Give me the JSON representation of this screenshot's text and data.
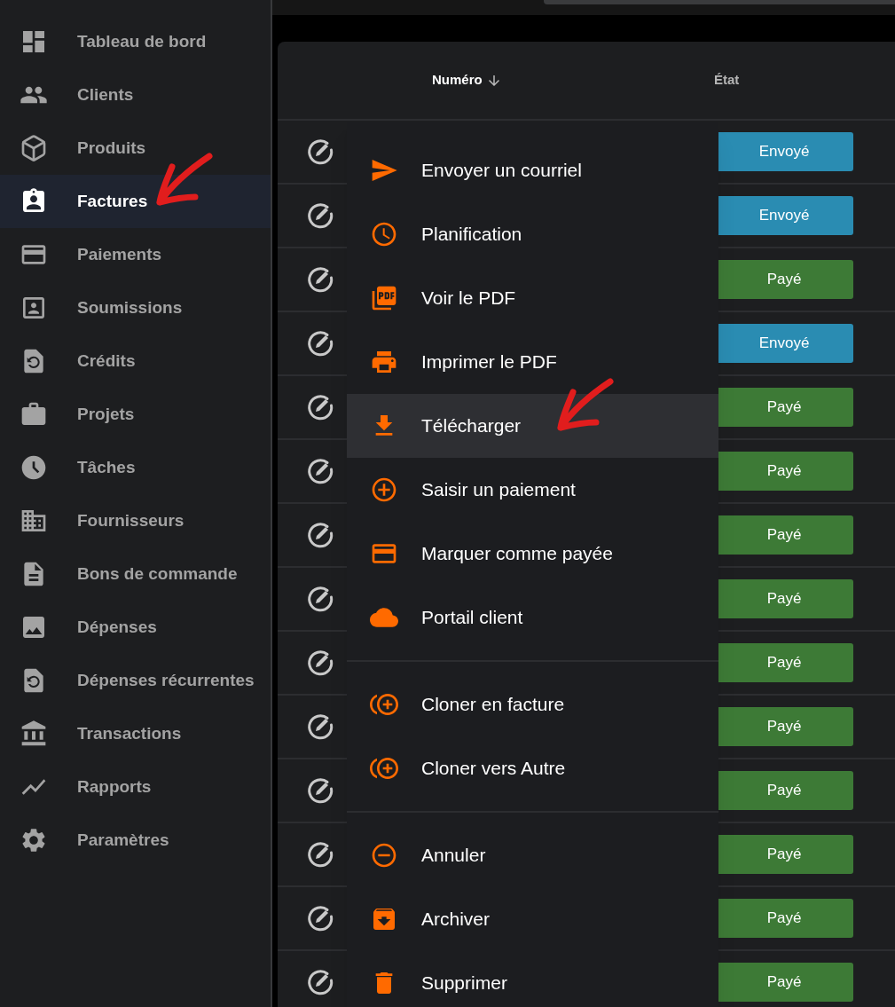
{
  "sidebar": {
    "items": [
      {
        "label": "Tableau de bord",
        "selected": false
      },
      {
        "label": "Clients",
        "selected": false
      },
      {
        "label": "Produits",
        "selected": false
      },
      {
        "label": "Factures",
        "selected": true
      },
      {
        "label": "Paiements",
        "selected": false
      },
      {
        "label": "Soumissions",
        "selected": false
      },
      {
        "label": "Crédits",
        "selected": false
      },
      {
        "label": "Projets",
        "selected": false
      },
      {
        "label": "Tâches",
        "selected": false
      },
      {
        "label": "Fournisseurs",
        "selected": false
      },
      {
        "label": "Bons de commande",
        "selected": false
      },
      {
        "label": "Dépenses",
        "selected": false
      },
      {
        "label": "Dépenses récurrentes",
        "selected": false
      },
      {
        "label": "Transactions",
        "selected": false
      },
      {
        "label": "Rapports",
        "selected": false
      },
      {
        "label": "Paramètres",
        "selected": false
      }
    ]
  },
  "table": {
    "columns": [
      {
        "label": "Numéro",
        "sorted": true
      },
      {
        "label": "État",
        "sorted": false
      }
    ],
    "rows": [
      {
        "status": {
          "label": "Envoyé",
          "color": "#2a8cb2"
        }
      },
      {
        "status": {
          "label": "Envoyé",
          "color": "#2a8cb2"
        }
      },
      {
        "status": {
          "label": "Payé",
          "color": "#3d7a36"
        }
      },
      {
        "status": {
          "label": "Envoyé",
          "color": "#2a8cb2"
        }
      },
      {
        "status": {
          "label": "Payé",
          "color": "#3d7a36"
        }
      },
      {
        "status": {
          "label": "Payé",
          "color": "#3d7a36"
        }
      },
      {
        "status": {
          "label": "Payé",
          "color": "#3d7a36"
        }
      },
      {
        "status": {
          "label": "Payé",
          "color": "#3d7a36"
        }
      },
      {
        "status": {
          "label": "Payé",
          "color": "#3d7a36"
        }
      },
      {
        "status": {
          "label": "Payé",
          "color": "#3d7a36"
        }
      },
      {
        "status": {
          "label": "Payé",
          "color": "#3d7a36"
        }
      },
      {
        "status": {
          "label": "Payé",
          "color": "#3d7a36"
        }
      },
      {
        "status": {
          "label": "Payé",
          "color": "#3d7a36"
        }
      },
      {
        "status": {
          "label": "Payé",
          "color": "#3d7a36"
        }
      }
    ]
  },
  "menu": {
    "groups": [
      [
        {
          "label": "Envoyer un courriel",
          "highlighted": false
        },
        {
          "label": "Planification",
          "highlighted": false
        },
        {
          "label": "Voir le PDF",
          "highlighted": false
        },
        {
          "label": "Imprimer le PDF",
          "highlighted": false
        },
        {
          "label": "Télécharger",
          "highlighted": true
        },
        {
          "label": "Saisir un paiement",
          "highlighted": false
        },
        {
          "label": "Marquer comme payée",
          "highlighted": false
        },
        {
          "label": "Portail client",
          "highlighted": false
        }
      ],
      [
        {
          "label": "Cloner en facture",
          "highlighted": false
        },
        {
          "label": "Cloner vers Autre",
          "highlighted": false
        }
      ],
      [
        {
          "label": "Annuler",
          "highlighted": false
        },
        {
          "label": "Archiver",
          "highlighted": false
        },
        {
          "label": "Supprimer",
          "highlighted": false
        }
      ]
    ]
  }
}
